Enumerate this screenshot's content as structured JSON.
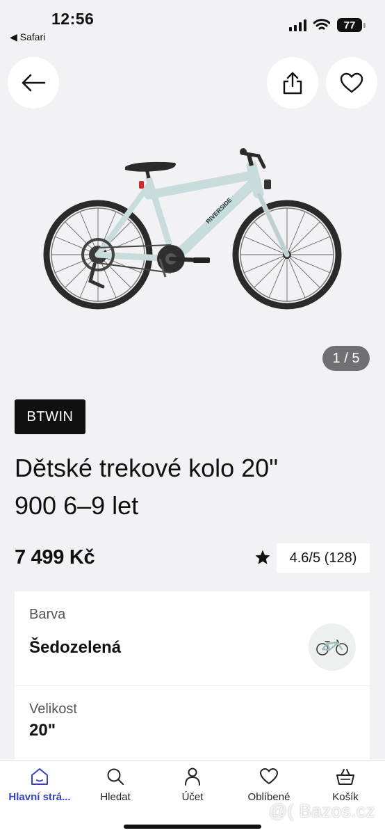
{
  "status_bar": {
    "time": "12:56",
    "back_app": "◀ Safari",
    "battery": "77"
  },
  "header": {
    "back_icon": "arrow-left-icon",
    "share_icon": "share-icon",
    "favorite_icon": "heart-icon"
  },
  "gallery": {
    "image_alt": "Dětské trekové kolo 20\" 900 6–9 let",
    "frame_lettering": "RIVERSIDE",
    "pager": "1 / 5"
  },
  "product": {
    "brand": "BTWIN",
    "title_line1": "Dětské trekové kolo 20\"",
    "title_line2": "900 6–9 let",
    "price": "7 499 Kč",
    "rating": "4.6/5 (128)"
  },
  "options": {
    "color_label": "Barva",
    "color_value": "Šedozelená",
    "size_label": "Velikost",
    "size_value": "20\""
  },
  "tabbar": {
    "items": [
      {
        "label": "Hlavní strá...",
        "icon": "home-icon",
        "active": true
      },
      {
        "label": "Hledat",
        "icon": "search-icon",
        "active": false
      },
      {
        "label": "Účet",
        "icon": "person-icon",
        "active": false
      },
      {
        "label": "Oblíbené",
        "icon": "heart-icon",
        "active": false
      },
      {
        "label": "Košík",
        "icon": "basket-icon",
        "active": false
      }
    ]
  },
  "watermark": "@( Bazos.cz",
  "colors": {
    "accent": "#3643ba",
    "background": "#f2f2f4",
    "bike_frame": "#c9dcdc",
    "badge": "#101010"
  }
}
